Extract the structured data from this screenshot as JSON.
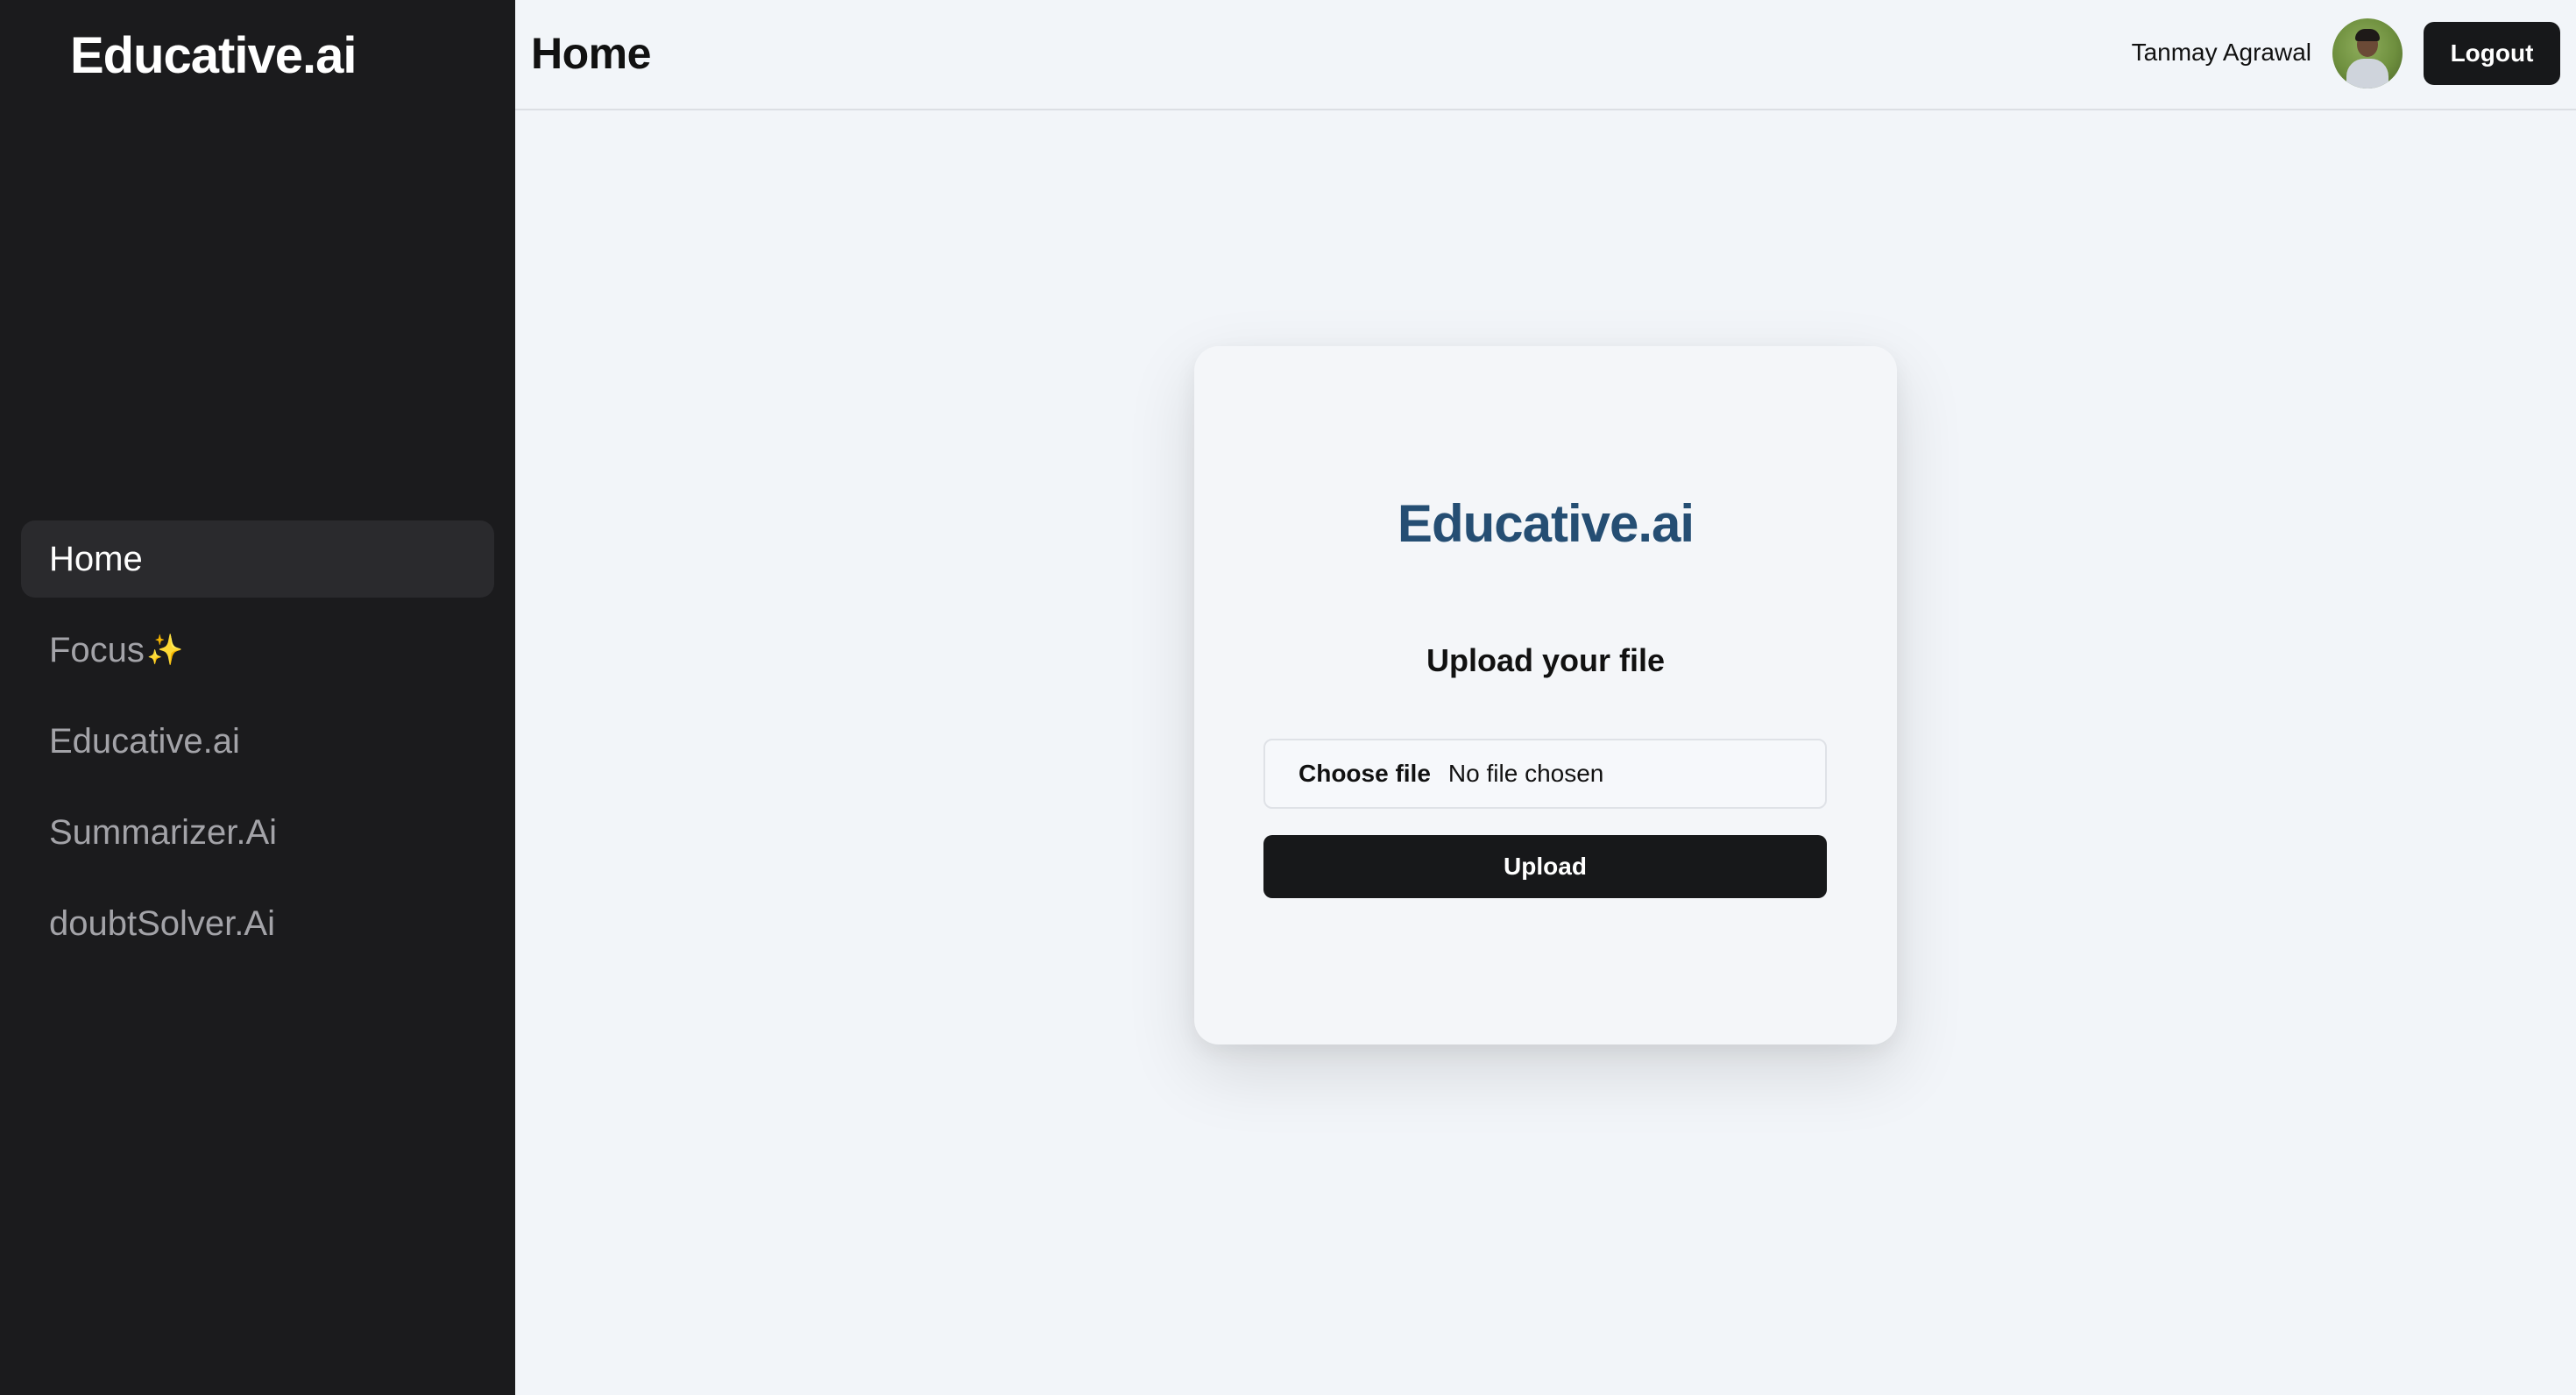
{
  "sidebar": {
    "brand": "Educative.ai",
    "items": [
      {
        "label": "Home",
        "active": true
      },
      {
        "label": "Focus",
        "icon": "sparkles-icon",
        "icon_glyph": "✨",
        "active": false
      },
      {
        "label": "Educative.ai",
        "active": false
      },
      {
        "label": "Summarizer.Ai",
        "active": false
      },
      {
        "label": "doubtSolver.Ai",
        "active": false
      }
    ]
  },
  "header": {
    "title": "Home",
    "user_name": "Tanmay Agrawal",
    "logout_label": "Logout"
  },
  "main": {
    "card_brand": "Educative.ai",
    "heading": "Upload your file",
    "choose_file_label": "Choose file",
    "file_status": "No file chosen",
    "upload_label": "Upload"
  },
  "colors": {
    "sidebar_bg": "#1b1b1d",
    "page_bg": "#f2f5f9",
    "brand_blue": "#254e73",
    "button_dark": "#17181a"
  }
}
